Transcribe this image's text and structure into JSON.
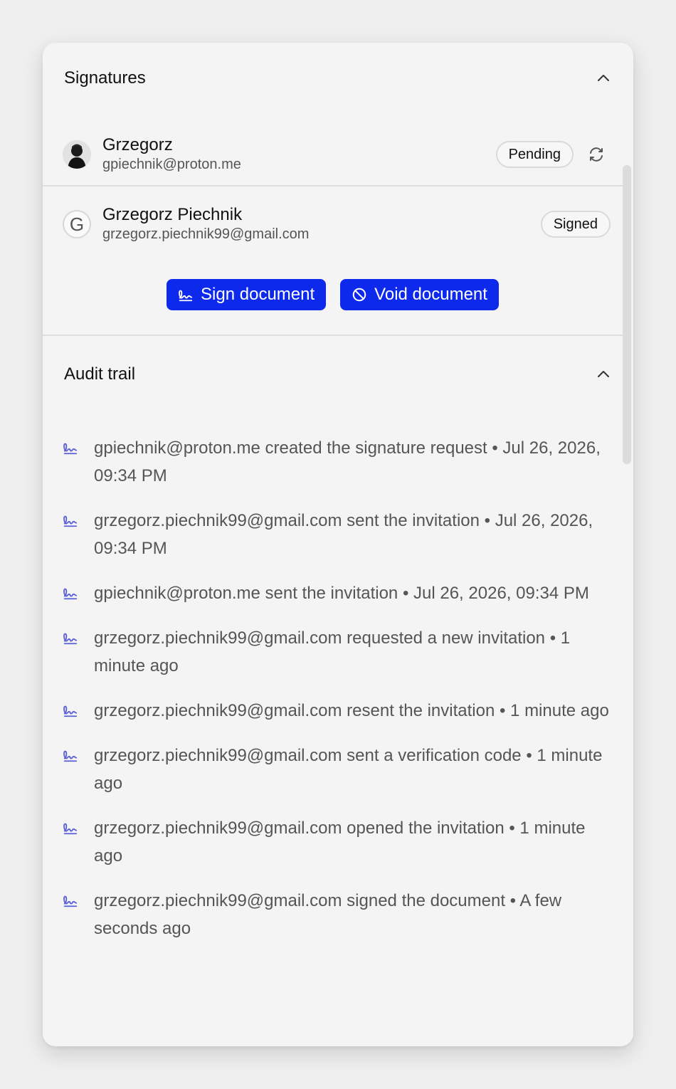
{
  "signatures": {
    "title": "Signatures",
    "signers": [
      {
        "name": "Grzegorz",
        "email": "gpiechnik@proton.me",
        "status": "Pending",
        "avatar": "photo"
      },
      {
        "name": "Grzegorz Piechnik",
        "email": "grzegorz.piechnik99@gmail.com",
        "status": "Signed",
        "avatar_letter": "G"
      }
    ],
    "sign_label": "Sign document",
    "void_label": "Void document"
  },
  "audit": {
    "title": "Audit trail",
    "items": [
      "gpiechnik@proton.me created the signature request • Jul 26, 2026, 09:34 PM",
      "grzegorz.piechnik99@gmail.com sent the invitation • Jul 26, 2026, 09:34 PM",
      "gpiechnik@proton.me sent the invitation • Jul 26, 2026, 09:34 PM",
      "grzegorz.piechnik99@gmail.com requested a new invitation • 1 minute ago",
      "grzegorz.piechnik99@gmail.com resent the invitation • 1 minute ago",
      "grzegorz.piechnik99@gmail.com sent a verification code • 1 minute ago",
      "grzegorz.piechnik99@gmail.com opened the invitation • 1 minute ago",
      "grzegorz.piechnik99@gmail.com signed the document • A few seconds ago"
    ]
  },
  "colors": {
    "accent": "#0d29ec",
    "icon": "#5b5fd6"
  }
}
